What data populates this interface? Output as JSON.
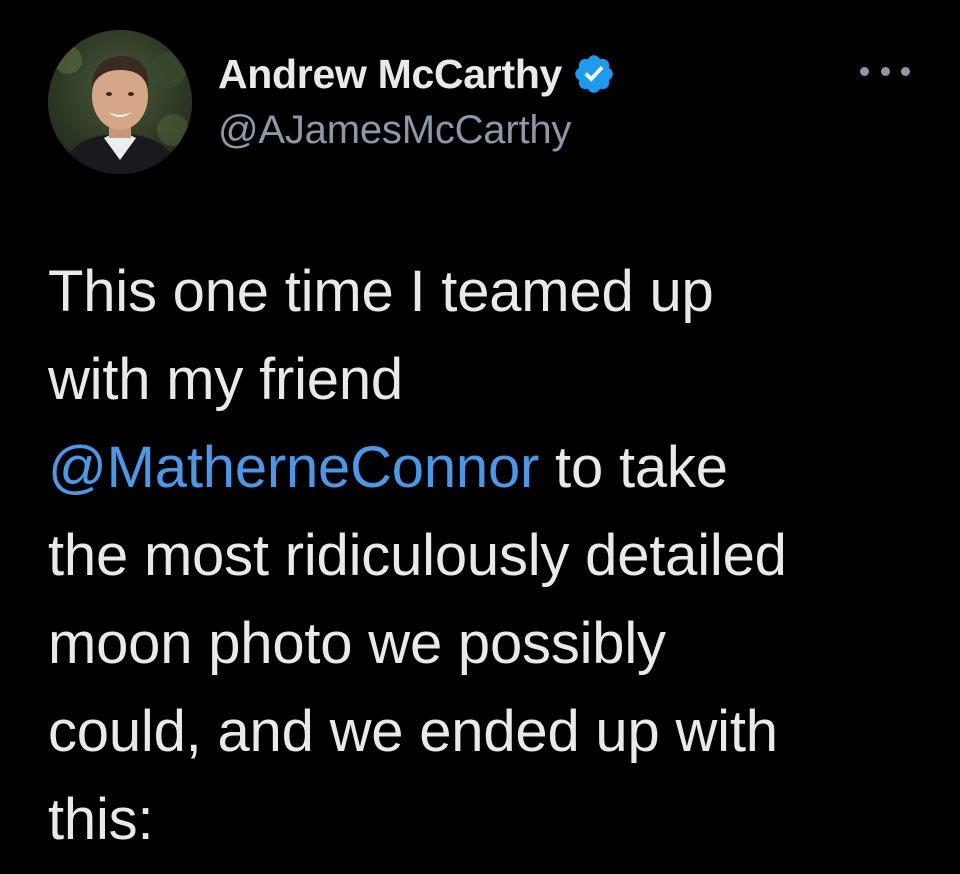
{
  "author": {
    "display_name": "Andrew McCarthy",
    "handle": "@AJamesMcCarthy",
    "verified_icon": "verified-badge-icon",
    "avatar_icon": "profile-photo"
  },
  "more_icon": "more-options-icon",
  "tweet": {
    "line1": "This one time I teamed up",
    "line2": "with my friend",
    "mention": "@MatherneConnor",
    "line3_rest": " to take",
    "line4": "the most ridiculously detailed",
    "line5": "moon photo we possibly",
    "line6": "could, and we ended up with",
    "line7": "this:"
  },
  "colors": {
    "background": "#000000",
    "text": "#e7e9ea",
    "secondary": "#8b98a5",
    "link": "#4a99e9",
    "verified": "#1d9bf0"
  }
}
